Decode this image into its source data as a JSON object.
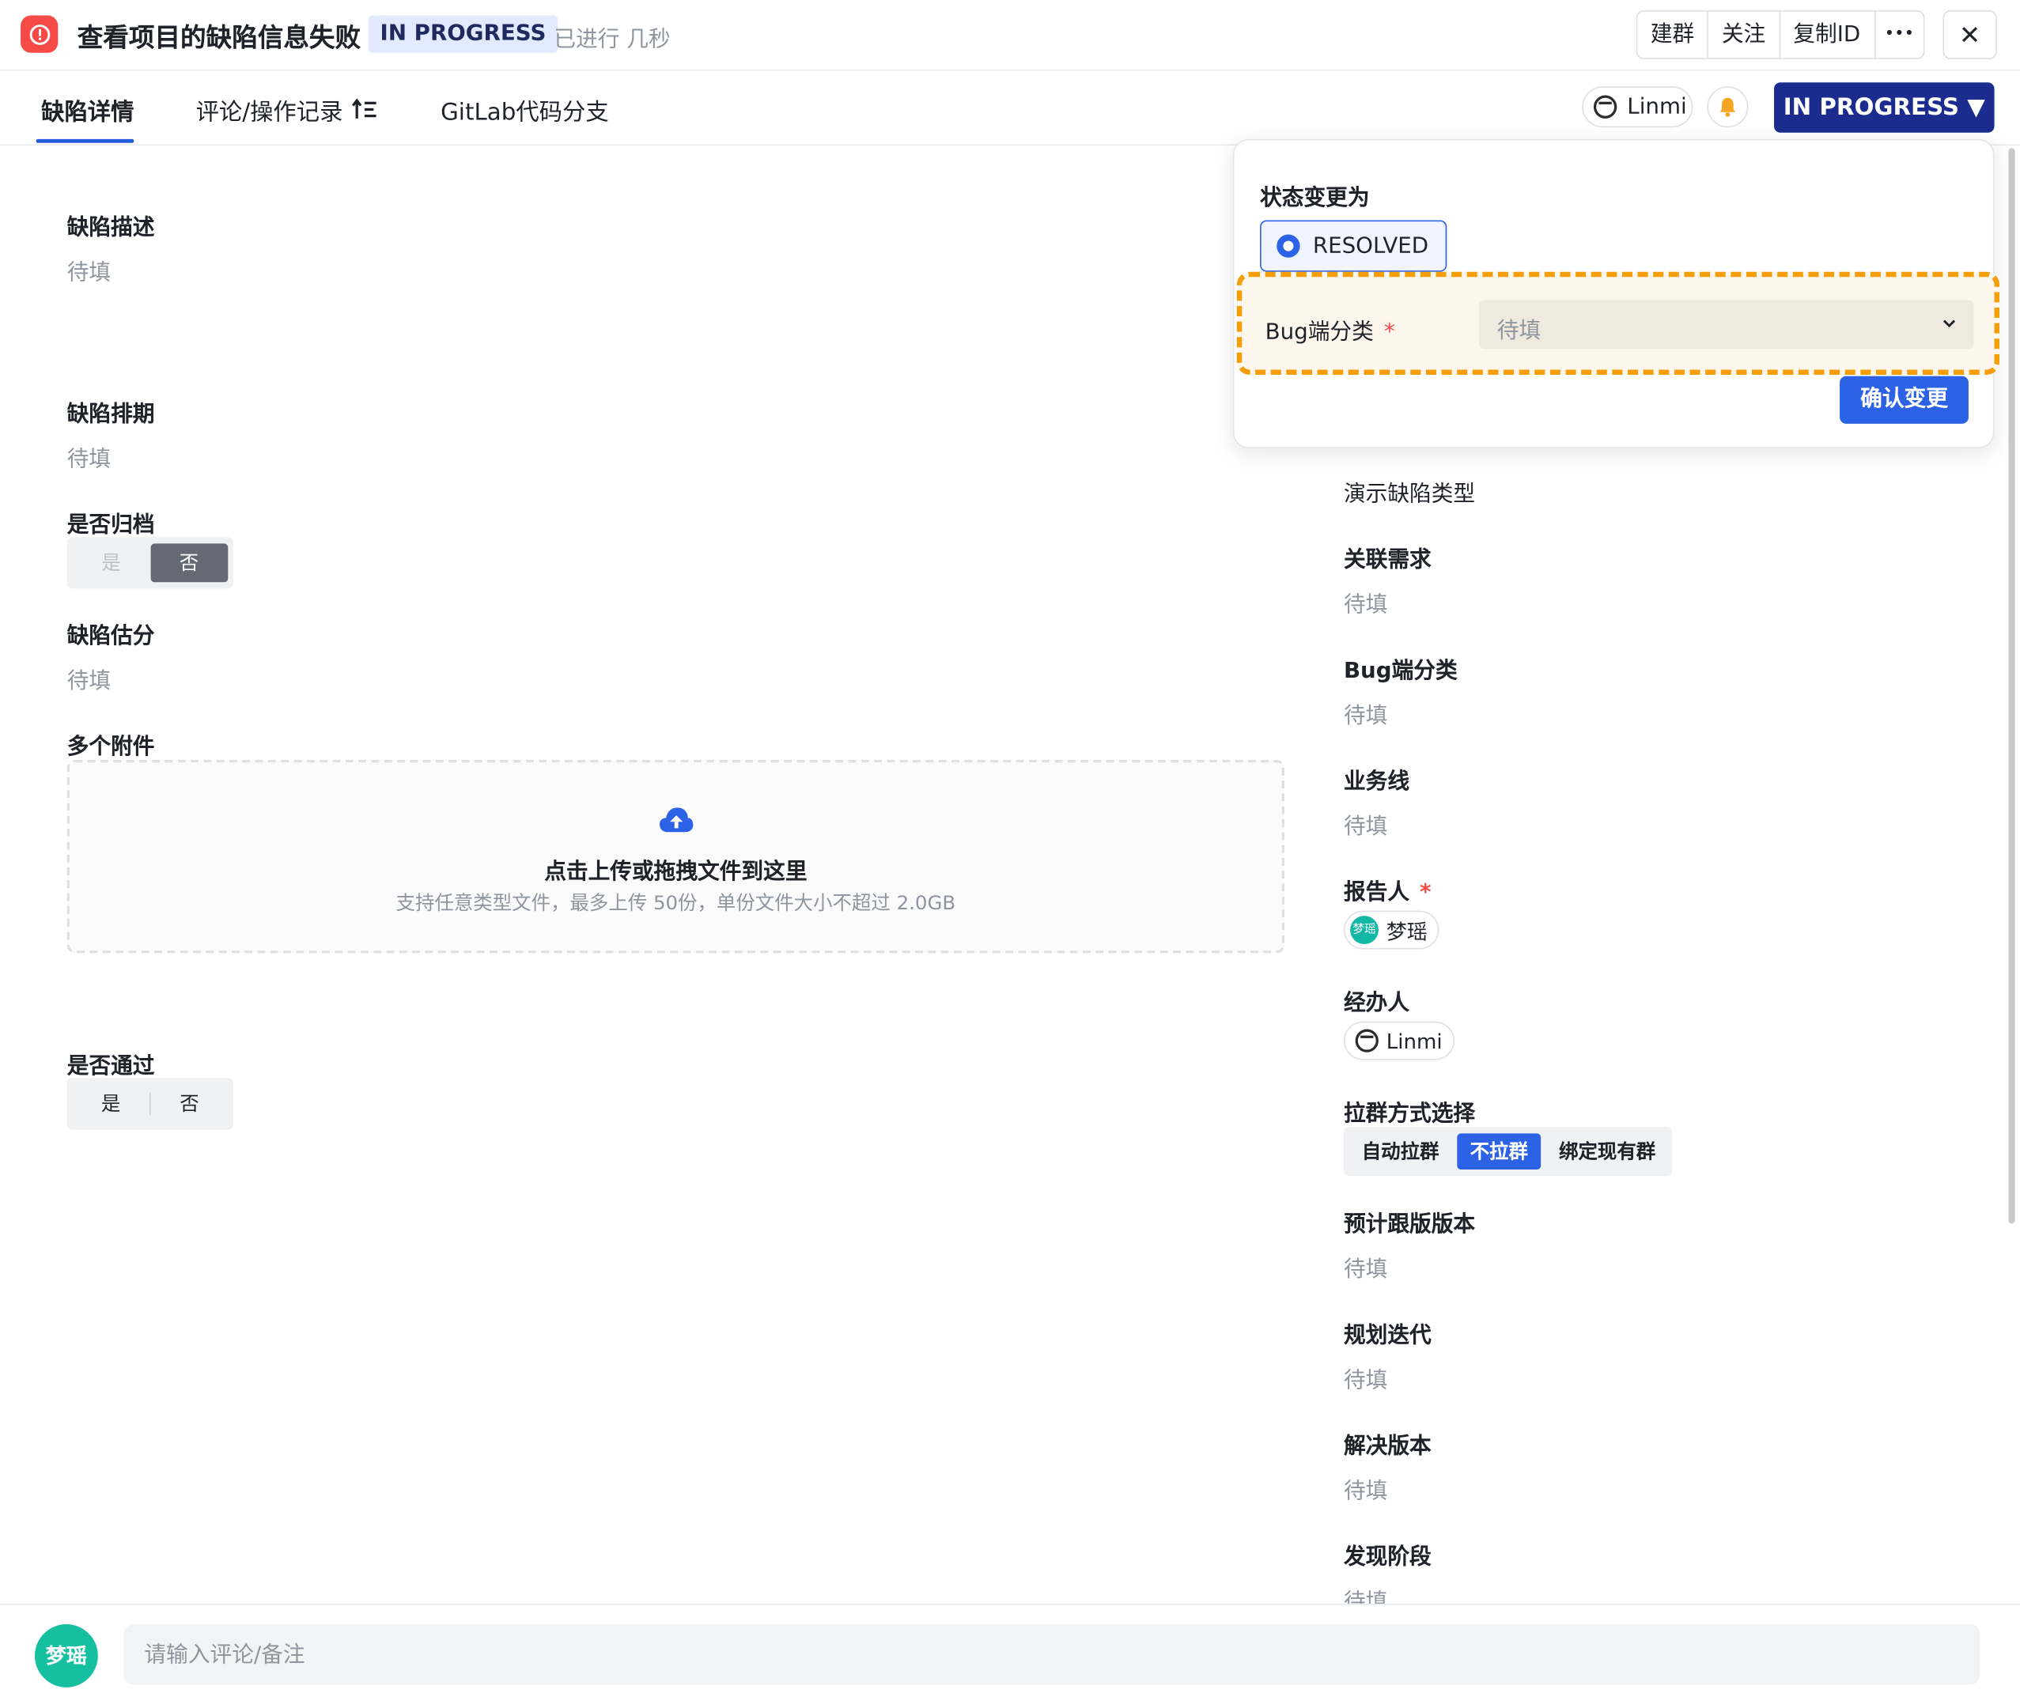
{
  "header": {
    "title": "查看项目的缺陷信息失败",
    "status": "IN PROGRESS",
    "elapsed": "已进行 几秒",
    "actions": [
      "建群",
      "关注",
      "复制ID",
      "•••"
    ],
    "close": "✕"
  },
  "tabs": [
    {
      "label": "缺陷详情",
      "active": true
    },
    {
      "label": "评论/操作记录",
      "active": false
    },
    {
      "label": "GitLab代码分支",
      "active": false
    }
  ],
  "toolbar": {
    "user": "Linmi",
    "status_button": "IN PROGRESS ▼"
  },
  "left_fields": {
    "description": {
      "label": "缺陷描述",
      "value": "待填"
    },
    "schedule": {
      "label": "缺陷排期",
      "value": "待填"
    },
    "archived": {
      "label": "是否归档",
      "options": [
        "是",
        "否"
      ],
      "selected": "否"
    },
    "estimate": {
      "label": "缺陷估分",
      "value": "待填"
    },
    "attachments": {
      "label": "多个附件",
      "upload_main": "点击上传或拖拽文件到这里",
      "upload_sub": "支持任意类型文件，最多上传 50份，单份文件大小不超过 2.0GB"
    },
    "passed": {
      "label": "是否通过",
      "options": [
        "是",
        "否"
      ]
    }
  },
  "right_fields": {
    "defect_type": {
      "value": "演示缺陷类型"
    },
    "related_req": {
      "label": "关联需求",
      "value": "待填"
    },
    "bug_side": {
      "label": "Bug端分类",
      "value": "待填"
    },
    "business_line": {
      "label": "业务线",
      "value": "待填"
    },
    "reporter": {
      "label": "报告人",
      "required_mark": "*",
      "avatar_text": "梦瑶",
      "name": "梦瑶"
    },
    "assignee": {
      "label": "经办人",
      "name": "Linmi"
    },
    "group_mode": {
      "label": "拉群方式选择",
      "options": [
        "自动拉群",
        "不拉群",
        "绑定现有群"
      ],
      "selected": "不拉群"
    },
    "planned_version": {
      "label": "预计跟版版本",
      "value": "待填"
    },
    "planned_iteration": {
      "label": "规划迭代",
      "value": "待填"
    },
    "resolve_version": {
      "label": "解决版本",
      "value": "待填"
    },
    "found_stage": {
      "label": "发现阶段",
      "value": "待填"
    }
  },
  "popover": {
    "title": "状态变更为",
    "option": "RESOLVED",
    "field_label": "Bug端分类",
    "required_mark": "*",
    "field_placeholder": "待填",
    "confirm": "确认变更"
  },
  "comment": {
    "avatar": "梦瑶",
    "placeholder": "请输入评论/备注"
  },
  "colors": {
    "primary": "#2c63e6",
    "status_button": "#1c2c8e",
    "bug_icon": "#f54a45",
    "highlight_border": "#f59e0b",
    "avatar_teal": "#14c0a0"
  }
}
